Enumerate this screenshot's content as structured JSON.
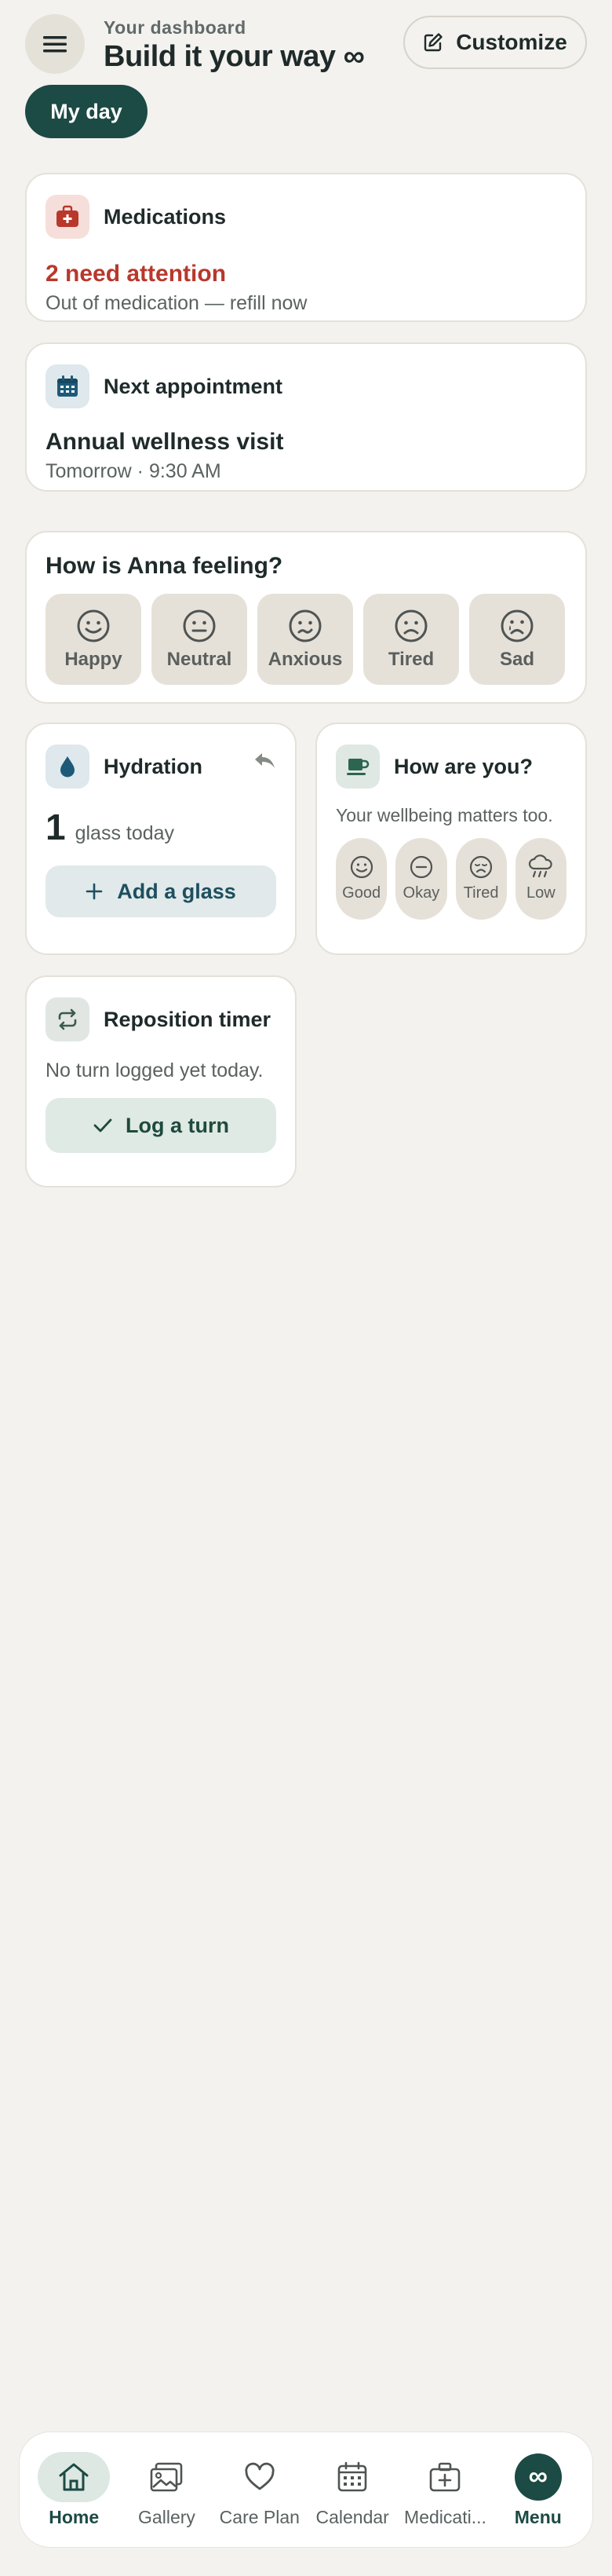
{
  "header": {
    "kicker": "Your dashboard",
    "title": "Build it your way ∞",
    "menu_icon": "hamburger-icon",
    "customize_label": "Customize"
  },
  "filter_chip": "My day",
  "medications": {
    "title": "Medications",
    "alert": "2 need attention",
    "subtitle": "Out of medication — refill now"
  },
  "appointment": {
    "title": "Next appointment",
    "name": "Annual wellness visit",
    "time": "Tomorrow · 9:30 AM"
  },
  "feeling": {
    "title": "How is Anna feeling?",
    "options": [
      {
        "label": "Happy",
        "icon": "happy-face-icon"
      },
      {
        "label": "Neutral",
        "icon": "neutral-face-icon"
      },
      {
        "label": "Anxious",
        "icon": "anxious-face-icon"
      },
      {
        "label": "Tired",
        "icon": "tired-face-icon"
      },
      {
        "label": "Sad",
        "icon": "sad-face-icon"
      }
    ]
  },
  "hydration": {
    "title": "Hydration",
    "count": "1",
    "unit": "glass today",
    "button": "Add a glass"
  },
  "wellbeing": {
    "title": "How are you?",
    "subtitle": "Your wellbeing matters too.",
    "options": [
      {
        "label": "Good",
        "icon": "smile-icon"
      },
      {
        "label": "Okay",
        "icon": "minus-circle-icon"
      },
      {
        "label": "Tired",
        "icon": "tired-face-icon"
      },
      {
        "label": "Low",
        "icon": "rain-cloud-icon"
      }
    ]
  },
  "reposition": {
    "title": "Reposition timer",
    "subtitle": "No turn logged yet today.",
    "button": "Log a turn"
  },
  "nav": {
    "items": [
      {
        "label": "Home",
        "icon": "home-icon"
      },
      {
        "label": "Gallery",
        "icon": "gallery-icon"
      },
      {
        "label": "Care Plan",
        "icon": "heart-icon"
      },
      {
        "label": "Calendar",
        "icon": "calendar-icon"
      },
      {
        "label": "Medicati...",
        "icon": "medical-kit-icon"
      },
      {
        "label": "Menu",
        "icon": "infinity-icon",
        "symbol": "∞"
      }
    ]
  }
}
